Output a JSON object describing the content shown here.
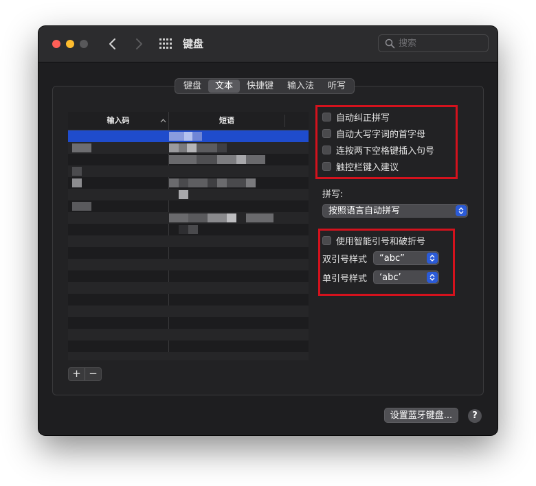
{
  "window": {
    "title": "键盘",
    "search_placeholder": "搜索"
  },
  "tabs": [
    {
      "label": "键盘",
      "active": false
    },
    {
      "label": "文本",
      "active": true
    },
    {
      "label": "快捷键",
      "active": false
    },
    {
      "label": "输入法",
      "active": false
    },
    {
      "label": "听写",
      "active": false
    }
  ],
  "table": {
    "headers": {
      "code": "输入码",
      "phrase": "短语"
    },
    "selected_row": 0
  },
  "buttons": {
    "add": "+",
    "remove": "−",
    "bluetooth": "设置蓝牙键盘...",
    "help": "?"
  },
  "options": {
    "autocorrect": "自动纠正拼写",
    "capitalize": "自动大写字词的首字母",
    "period": "连按两下空格键插入句号",
    "touchbar": "触控栏键入建议",
    "smart_quotes": "使用智能引号和破折号"
  },
  "spelling": {
    "label": "拼写:",
    "value": "按照语言自动拼写"
  },
  "quotes": {
    "double_label": "双引号样式",
    "double_value": "“abc”",
    "single_label": "单引号样式",
    "single_value": "‘abc’"
  },
  "colors": {
    "accent": "#2b5bd8",
    "highlight_box": "#d4121d",
    "selection": "#1f4ccc"
  }
}
